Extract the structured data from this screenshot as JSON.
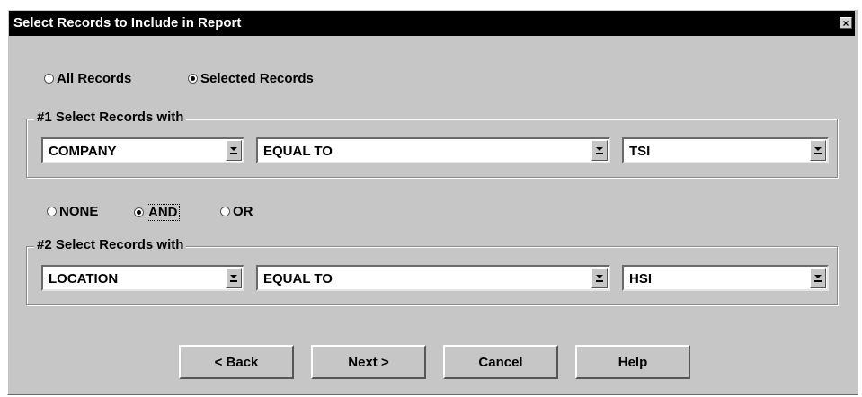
{
  "window": {
    "title": "Select Records to Include in Report",
    "close_label": "×"
  },
  "scope": {
    "all_label": "All Records",
    "selected_label": "Selected Records",
    "selected": "Selected Records"
  },
  "group1": {
    "legend": "#1 Select Records with",
    "field": "COMPANY",
    "operator": "EQUAL TO",
    "value": "TSI"
  },
  "logic": {
    "none_label": "NONE",
    "and_label": "AND",
    "or_label": "OR",
    "selected": "AND"
  },
  "group2": {
    "legend": "#2 Select Records with",
    "field": "LOCATION",
    "operator": "EQUAL TO",
    "value": "HSI"
  },
  "buttons": {
    "back": "< Back",
    "next": "Next >",
    "cancel": "Cancel",
    "help": "Help"
  }
}
